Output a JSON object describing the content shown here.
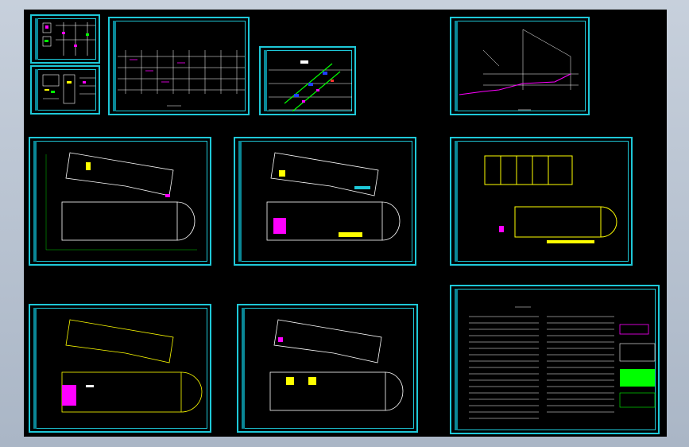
{
  "viewport": {
    "background": "#000000"
  },
  "colors": {
    "frame": "#1ec8d8",
    "yellow": "#ffff00",
    "white": "#ffffff",
    "magenta": "#ff00ff",
    "green": "#00ff00",
    "blue": "#2040ff",
    "red": "#ff3030"
  },
  "sheets": [
    {
      "id": "detail-a",
      "kind": "details"
    },
    {
      "id": "detail-b",
      "kind": "details"
    },
    {
      "id": "riser-diagram",
      "kind": "riser"
    },
    {
      "id": "isometric-diagram",
      "kind": "isometric"
    },
    {
      "id": "pipe-system",
      "kind": "system"
    },
    {
      "id": "plan-ground",
      "kind": "plan"
    },
    {
      "id": "plan-floor-2",
      "kind": "plan"
    },
    {
      "id": "plan-roof",
      "kind": "plan"
    },
    {
      "id": "plan-floor-3",
      "kind": "plan"
    },
    {
      "id": "plan-floor-4",
      "kind": "plan"
    },
    {
      "id": "design-notes",
      "kind": "notes"
    }
  ]
}
